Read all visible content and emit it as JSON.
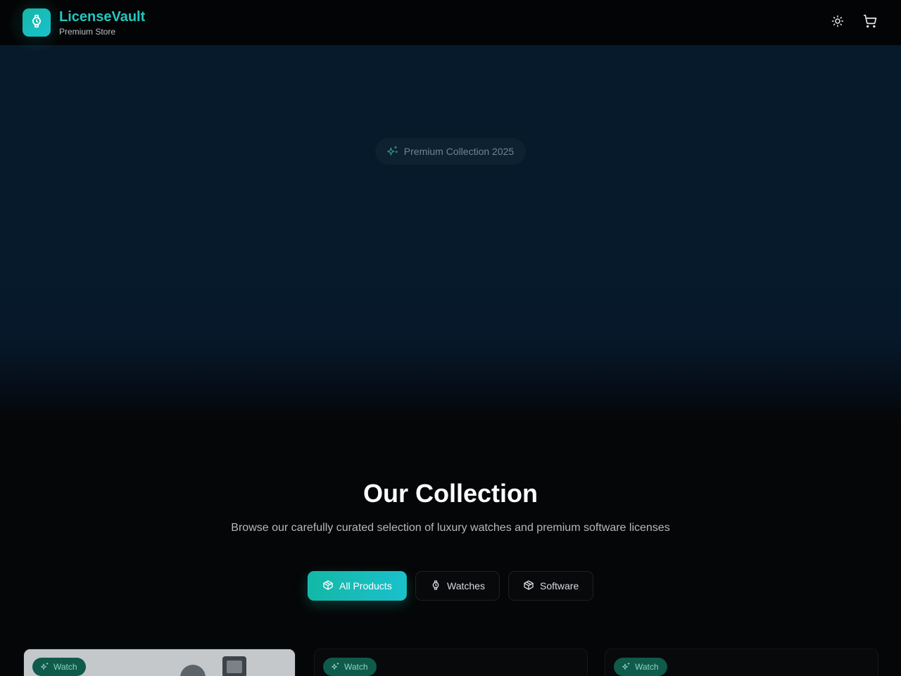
{
  "brand": {
    "name": "LicenseVault",
    "tagline": "Premium Store",
    "icon": "watch-icon"
  },
  "header": {
    "actions": [
      {
        "icon": "sun-icon"
      },
      {
        "icon": "cart-icon"
      }
    ]
  },
  "hero": {
    "badge": "Premium Collection 2025",
    "badge_icon": "sparkles-icon"
  },
  "collection": {
    "title": "Our Collection",
    "subtitle": "Browse our carefully curated selection of luxury watches and premium software licenses",
    "filters": [
      {
        "label": "All Products",
        "icon": "package-icon",
        "active": true
      },
      {
        "label": "Watches",
        "icon": "watch-icon",
        "active": false
      },
      {
        "label": "Software",
        "icon": "package-icon",
        "active": false
      }
    ]
  },
  "products": [
    {
      "badge": "Watch"
    },
    {
      "badge": "Watch"
    },
    {
      "badge": "Watch"
    }
  ],
  "colors": {
    "accent": "#14b8a6",
    "accent_text": "#22c7c0",
    "hero_bg": "#061a2b",
    "page_bg": "#050607"
  }
}
